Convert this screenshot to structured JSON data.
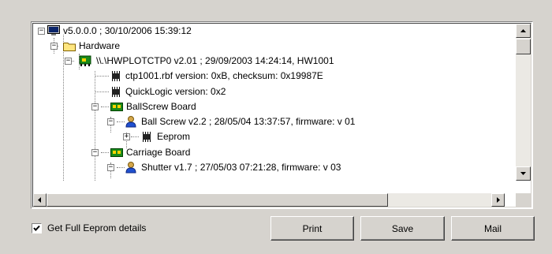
{
  "tree": {
    "nodes": [
      {
        "label": "v5.0.0.0 ; 30/10/2006 15:39:12",
        "toggle": "−",
        "icon": "computer-icon"
      },
      {
        "label": "Hardware",
        "toggle": "−",
        "icon": "folder-icon"
      },
      {
        "label": "\\\\.\\HWPLOTCTP0 v2.01 ; 29/09/2003 14:24:14, HW1001",
        "toggle": "−",
        "icon": "board-icon"
      },
      {
        "label": "ctp1001.rbf version: 0xB, checksum: 0x19987E",
        "toggle": "",
        "icon": "chip-icon"
      },
      {
        "label": "QuickLogic version: 0x2",
        "toggle": "",
        "icon": "chip-icon"
      },
      {
        "label": "BallScrew Board",
        "toggle": "−",
        "icon": "circuit-board-icon"
      },
      {
        "label": "Ball Screw v2.2 ; 28/05/04 13:37:57, firmware: v 01",
        "toggle": "−",
        "icon": "user-icon"
      },
      {
        "label": "Eeprom",
        "toggle": "+",
        "icon": "chip-icon"
      },
      {
        "label": "Carriage Board",
        "toggle": "−",
        "icon": "circuit-board-icon"
      },
      {
        "label": "Shutter v1.7 ; 27/05/03 07:21:28, firmware: v 03",
        "toggle": "−",
        "icon": "user-icon"
      }
    ],
    "vscroll": {
      "up_icon": "arrow-up-icon",
      "down_icon": "arrow-down-icon"
    },
    "hscroll": {
      "left_icon": "arrow-left-icon",
      "right_icon": "arrow-right-icon"
    }
  },
  "options": {
    "full_eeprom_label": "Get Full Eeprom details",
    "full_eeprom_checked": true
  },
  "buttons": {
    "print": "Print",
    "save": "Save",
    "mail": "Mail"
  }
}
